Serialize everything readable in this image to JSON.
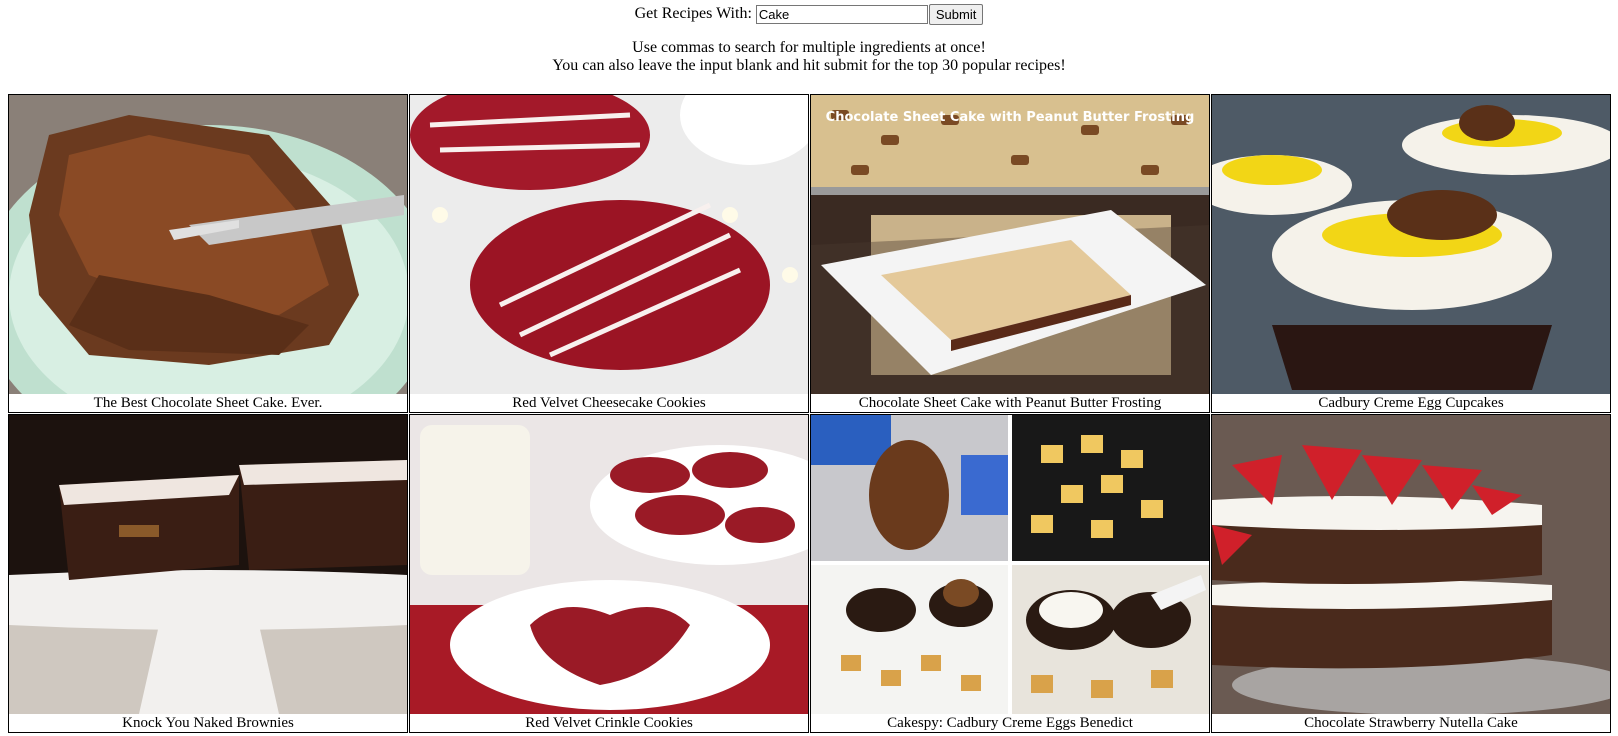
{
  "search": {
    "label": "Get Recipes With:",
    "value": "Cake",
    "submit_label": "Submit"
  },
  "help": {
    "line1": "Use commas to search for multiple ingredients at once!",
    "line2": "You can also leave the input blank and hit submit for the top 30 popular recipes!"
  },
  "recipes": [
    {
      "title": "The Best Chocolate Sheet Cake. Ever."
    },
    {
      "title": "Red Velvet Cheesecake Cookies"
    },
    {
      "title": "Chocolate Sheet Cake with Peanut Butter Frosting",
      "photo_text": "Chocolate Sheet Cake with Peanut Butter Frosting"
    },
    {
      "title": "Cadbury Creme Egg Cupcakes"
    },
    {
      "title": "Knock You Naked Brownies"
    },
    {
      "title": "Red Velvet Crinkle Cookies"
    },
    {
      "title": "Cakespy: Cadbury Creme Eggs Benedict"
    },
    {
      "title": "Chocolate Strawberry Nutella Cake"
    }
  ]
}
